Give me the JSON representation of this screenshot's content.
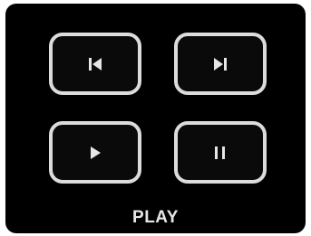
{
  "panel": {
    "label": "PLAY",
    "buttons": [
      {
        "name": "previous",
        "icon": "skip-previous-icon"
      },
      {
        "name": "next",
        "icon": "skip-next-icon"
      },
      {
        "name": "play",
        "icon": "play-icon"
      },
      {
        "name": "pause",
        "icon": "pause-icon"
      }
    ]
  },
  "colors": {
    "panel_background": "#000000",
    "button_border": "#dcdcdc",
    "icon": "#e6e6e6",
    "label": "#e6e6e6"
  }
}
